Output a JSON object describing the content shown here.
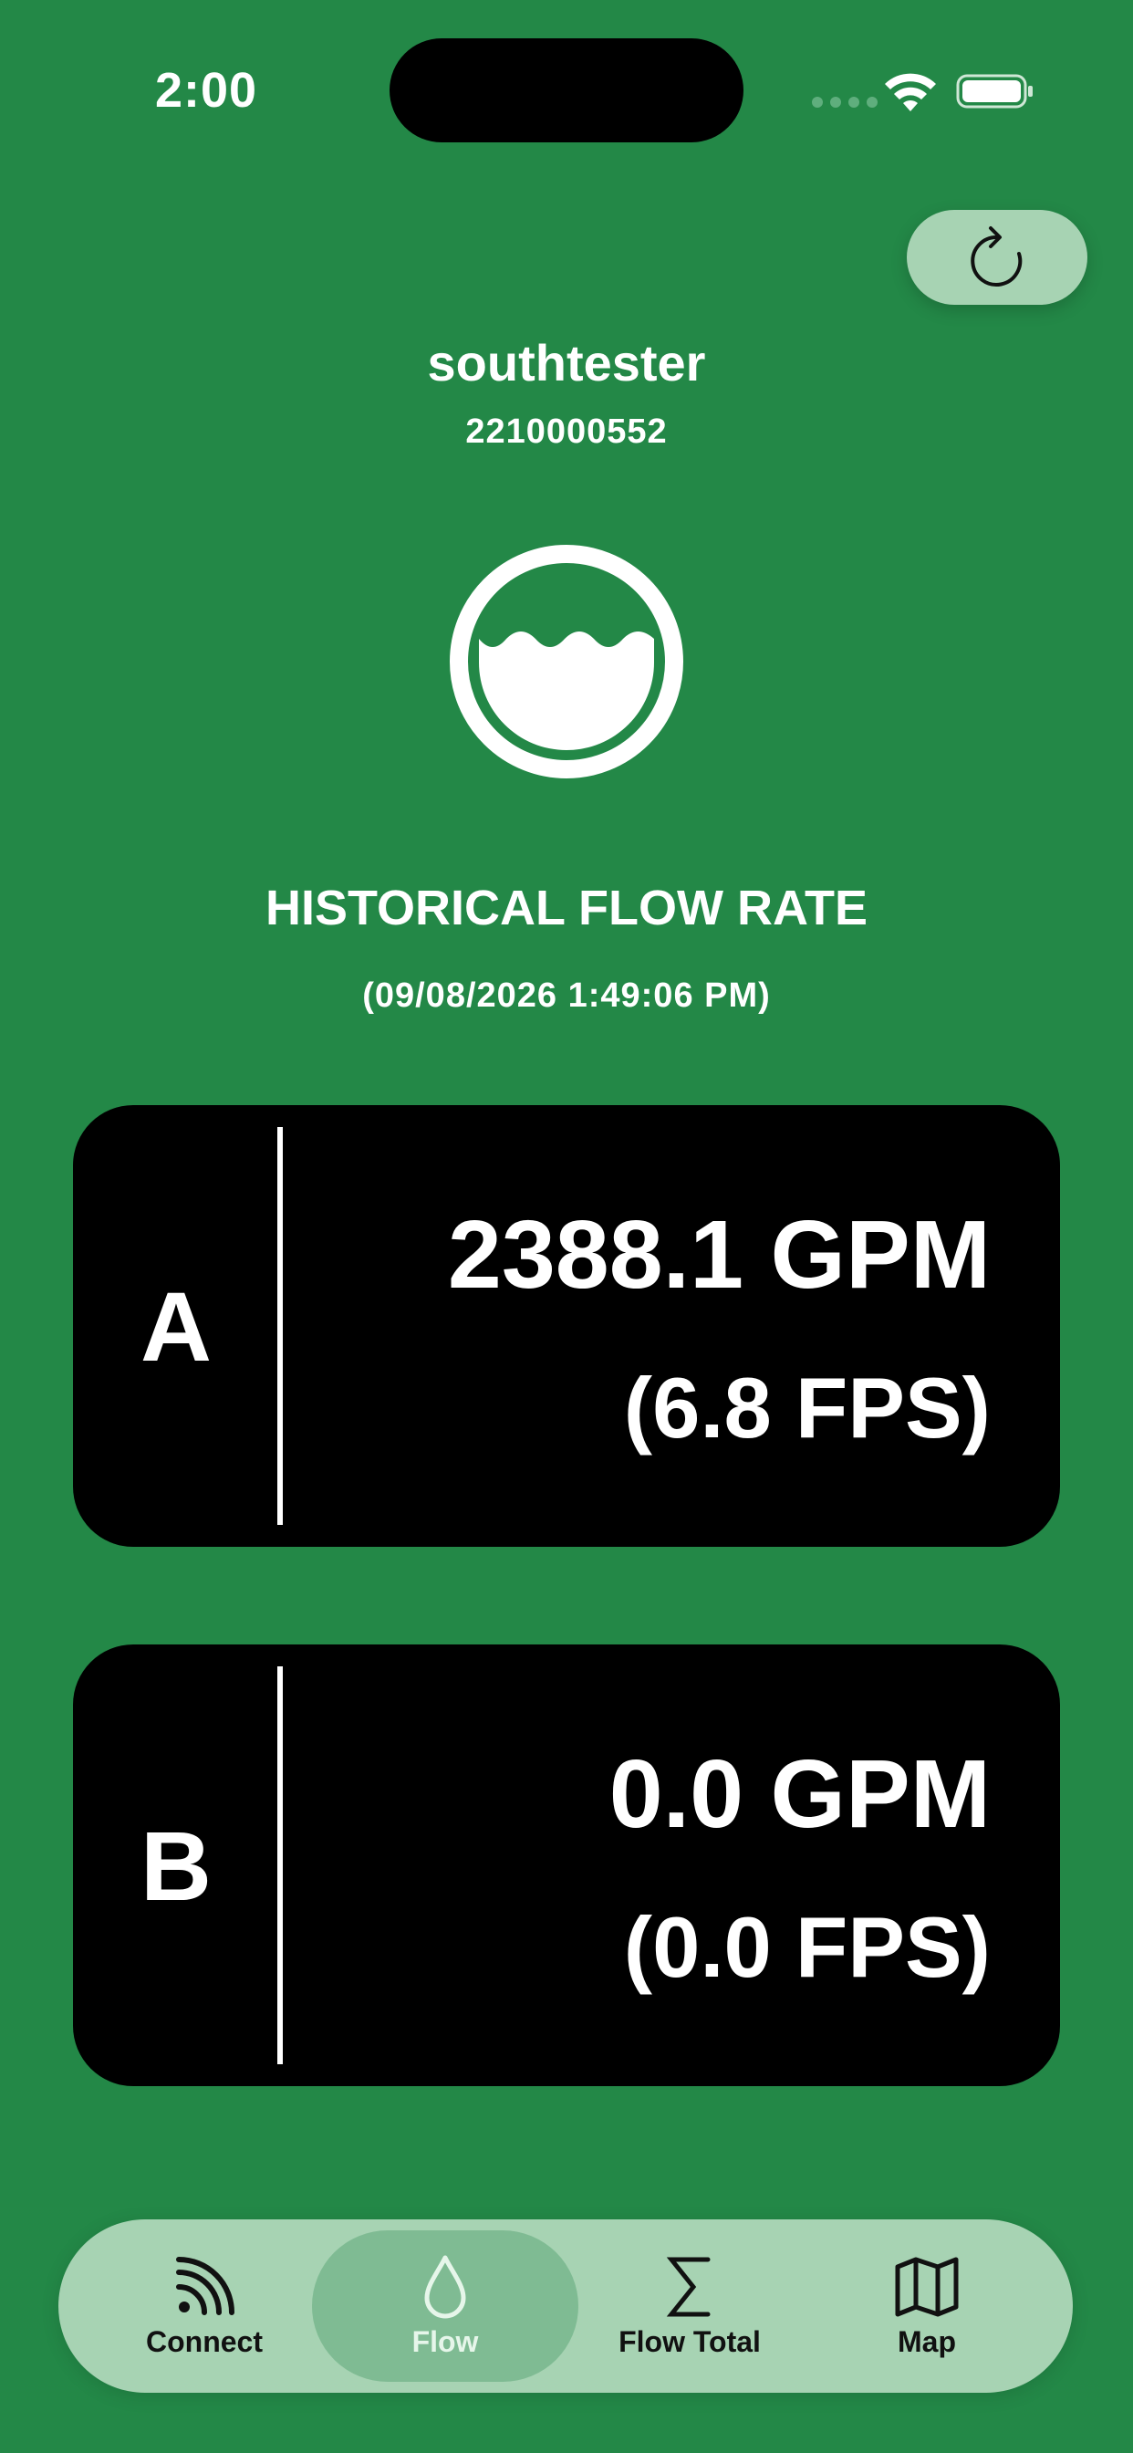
{
  "status_bar": {
    "time": "2:00"
  },
  "device": {
    "name": "southtester",
    "serial": "2210000552"
  },
  "section": {
    "title": "HISTORICAL FLOW RATE",
    "timestamp": "(09/08/2026 1:49:06 PM)"
  },
  "channels": [
    {
      "letter": "A",
      "rate": "2388.1 GPM",
      "velocity": "(6.8 FPS)"
    },
    {
      "letter": "B",
      "rate": "0.0 GPM",
      "velocity": "(0.0 FPS)"
    }
  ],
  "tab_bar": {
    "items": [
      {
        "label": "Connect",
        "icon": "rss-signal-icon",
        "selected": false
      },
      {
        "label": "Flow",
        "icon": "water-drop-icon",
        "selected": true
      },
      {
        "label": "Flow Total",
        "icon": "sigma-icon",
        "selected": false
      },
      {
        "label": "Map",
        "icon": "map-icon",
        "selected": false
      }
    ]
  },
  "colors": {
    "background": "#238847",
    "card": "#000000",
    "tab_bar": "#a7d3b3",
    "tab_selected": "#7fbb93"
  }
}
